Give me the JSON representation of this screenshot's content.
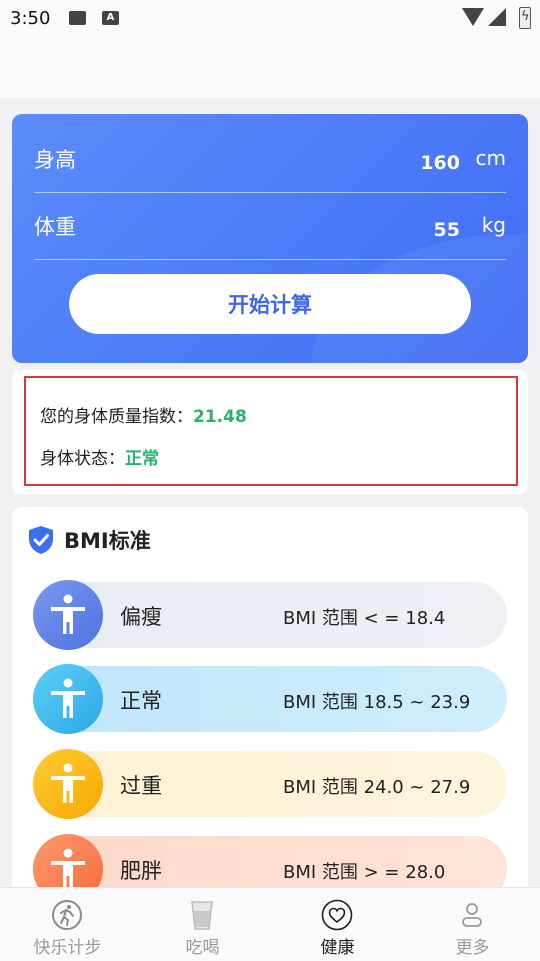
{
  "status_bar": {
    "time": "3:50",
    "photo_icon": "image-icon",
    "font_icon": "A"
  },
  "calculator": {
    "height_label": "身高",
    "height_value": "160",
    "height_unit": "cm",
    "weight_label": "体重",
    "weight_value": "55",
    "weight_unit": "kg",
    "button_label": "开始计算"
  },
  "result": {
    "bmi_label": "您的身体质量指数：",
    "bmi_value": "21.48",
    "status_label": "身体状态：",
    "status_value": "正常",
    "value_color": "#27b36a"
  },
  "bmi_standard": {
    "title": "BMI标准",
    "rows": [
      {
        "name": "偏瘦",
        "range": "BMI 范围 < = 18.4",
        "color": "#5b7fe6"
      },
      {
        "name": "正常",
        "range": "BMI 范围 18.5 ~ 23.9",
        "color": "#35b7ee"
      },
      {
        "name": "过重",
        "range": "BMI 范围 24.0 ~ 27.9",
        "color": "#f9b814"
      },
      {
        "name": "肥胖",
        "range": "BMI 范围 > = 28.0",
        "color": "#f77e4e"
      }
    ]
  },
  "tabs": [
    {
      "label": "快乐计步",
      "icon": "running-person-icon"
    },
    {
      "label": "吃喝",
      "icon": "cup-icon"
    },
    {
      "label": "健康",
      "icon": "heart-icon",
      "active": true
    },
    {
      "label": "更多",
      "icon": "profile-icon"
    }
  ]
}
